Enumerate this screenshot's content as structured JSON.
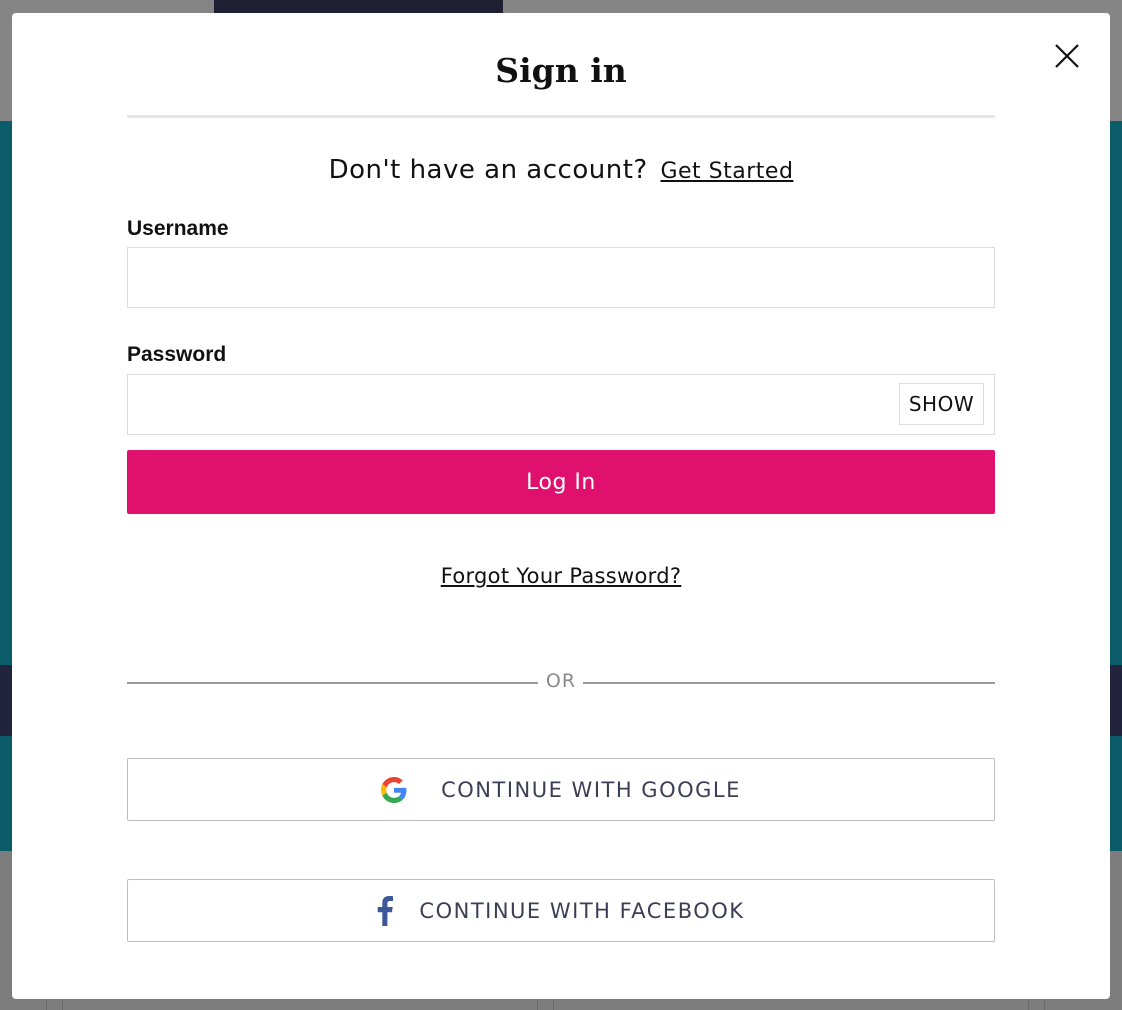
{
  "modal": {
    "title": "Sign in",
    "close_icon": "close-icon"
  },
  "signup": {
    "prompt": "Don't have an account?",
    "link": "Get Started"
  },
  "form": {
    "username": {
      "label": "Username",
      "value": "",
      "placeholder": ""
    },
    "password": {
      "label": "Password",
      "value": "",
      "placeholder": "",
      "show_label": "SHOW"
    },
    "login_label": "Log In",
    "forgot_label": "Forgot Your Password?"
  },
  "divider": {
    "label": "OR"
  },
  "social": {
    "google": {
      "label": "CONTINUE WITH GOOGLE",
      "icon": "google-icon"
    },
    "facebook": {
      "label": "CONTINUE WITH FACEBOOK",
      "icon": "facebook-icon"
    }
  },
  "colors": {
    "login_button": "#e0106e",
    "backdrop_hero": "#0b5d69",
    "backdrop_strip": "#21243c",
    "social_text": "#3a3f55",
    "facebook_blue": "#3b5998"
  }
}
